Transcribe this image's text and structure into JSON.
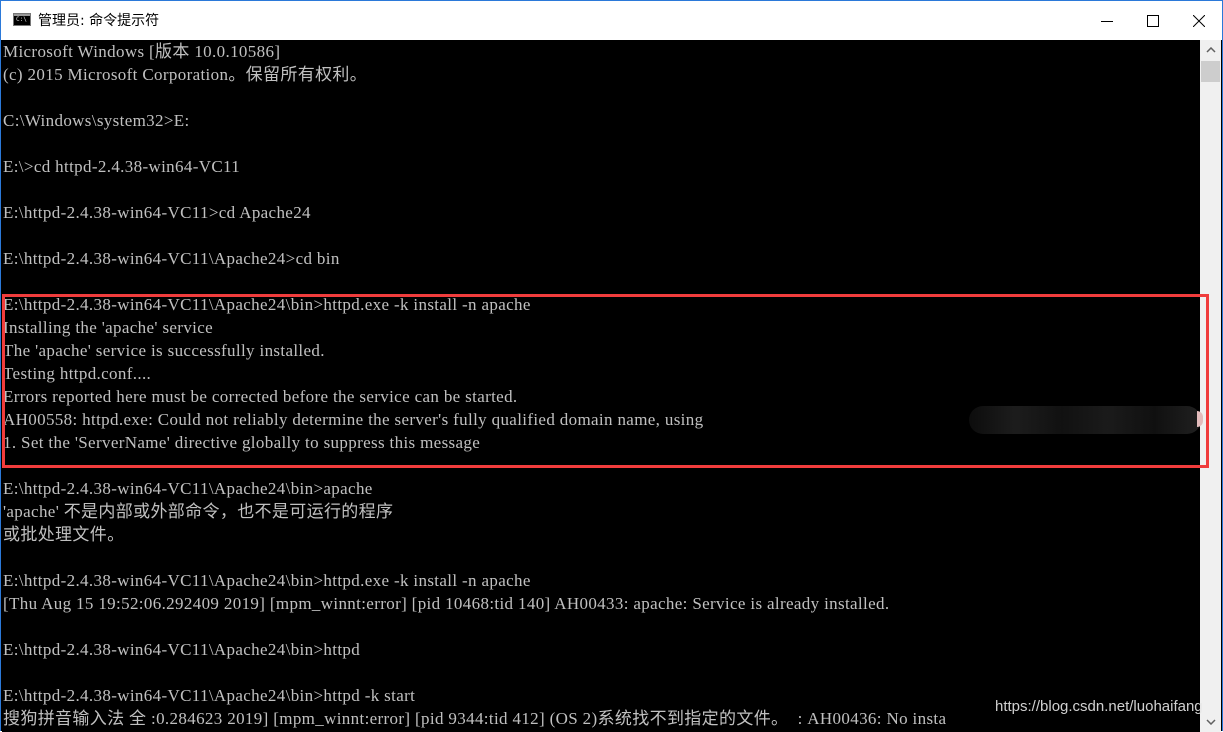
{
  "window": {
    "title": "管理员: 命令提示符",
    "icon": "cmd-icon",
    "controls": {
      "minimize": "minimize-icon",
      "maximize": "maximize-icon",
      "close": "close-icon"
    }
  },
  "console": {
    "lines": [
      "Microsoft Windows [版本 10.0.10586]",
      "(c) 2015 Microsoft Corporation。保留所有权利。",
      "",
      "C:\\Windows\\system32>E:",
      "",
      "E:\\>cd httpd-2.4.38-win64-VC11",
      "",
      "E:\\httpd-2.4.38-win64-VC11>cd Apache24",
      "",
      "E:\\httpd-2.4.38-win64-VC11\\Apache24>cd bin",
      "",
      "E:\\httpd-2.4.38-win64-VC11\\Apache24\\bin>httpd.exe -k install -n apache",
      "Installing the 'apache' service",
      "The 'apache' service is successfully installed.",
      "Testing httpd.conf....",
      "Errors reported here must be corrected before the service can be started.",
      "AH00558: httpd.exe: Could not reliably determine the server's fully qualified domain name, using",
      "1. Set the 'ServerName' directive globally to suppress this message",
      "",
      "E:\\httpd-2.4.38-win64-VC11\\Apache24\\bin>apache",
      "'apache' 不是内部或外部命令，也不是可运行的程序",
      "或批处理文件。",
      "",
      "E:\\httpd-2.4.38-win64-VC11\\Apache24\\bin>httpd.exe -k install -n apache",
      "[Thu Aug 15 19:52:06.292409 2019] [mpm_winnt:error] [pid 10468:tid 140] AH00433: apache: Service is already installed.",
      "",
      "E:\\httpd-2.4.38-win64-VC11\\Apache24\\bin>httpd",
      "",
      "E:\\httpd-2.4.38-win64-VC11\\Apache24\\bin>httpd -k start",
      "搜狗拼音输入法 全 :0.284623 2019] [mpm_winnt:error] [pid 9344:tid 412] (OS 2)系统找不到指定的文件。  : AH00436: No insta"
    ],
    "text_color": "#c0c0c0",
    "background": "#000000"
  },
  "annotation": {
    "highlight_color": "#f03c3c",
    "highlight_first_line": 11,
    "highlight_last_line": 17
  },
  "watermark": "https://blog.csdn.net/luohaifang",
  "scrollbar": {
    "up": "scroll-up-arrow-icon",
    "down": "scroll-down-arrow-icon"
  }
}
